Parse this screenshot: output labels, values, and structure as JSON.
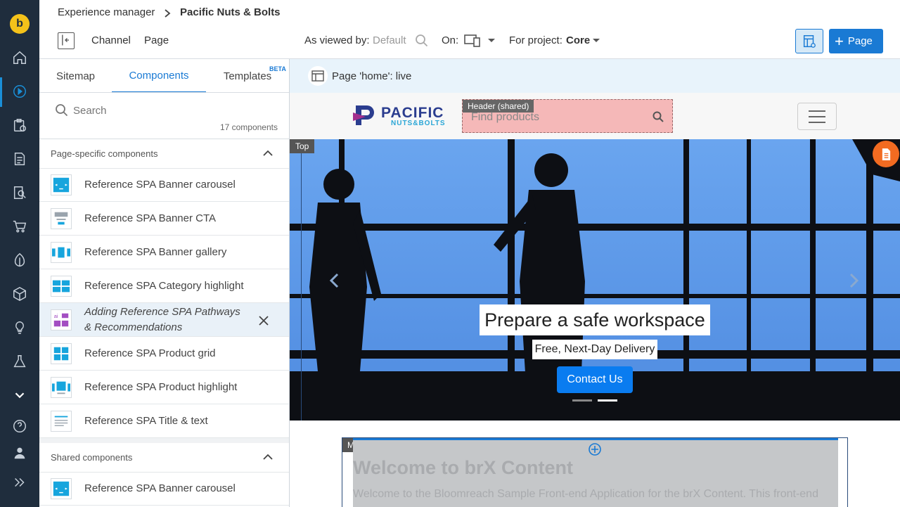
{
  "breadcrumb": {
    "root": "Experience manager",
    "current": "Pacific Nuts & Bolts"
  },
  "toolbar": {
    "channel": "Channel",
    "page": "Page",
    "viewed_by_label": "As viewed by:",
    "viewed_by_value": "Default",
    "on_label": "On:",
    "project_label": "For project:",
    "project_value": "Core",
    "new_page_button": "Page"
  },
  "tabs": {
    "sitemap": "Sitemap",
    "components": "Components",
    "templates": "Templates",
    "beta": "BETA"
  },
  "search": {
    "placeholder": "Search",
    "count": "17 components"
  },
  "sections": {
    "page_specific": "Page-specific components",
    "shared": "Shared components"
  },
  "components": [
    "Reference SPA Banner carousel",
    "Reference SPA Banner CTA",
    "Reference SPA Banner gallery",
    "Reference SPA Category highlight",
    "Adding Reference SPA Pathways & Recommendations",
    "Reference SPA Product grid",
    "Reference SPA Product highlight",
    "Reference SPA Title & text"
  ],
  "shared_components": [
    "Reference SPA Banner carousel"
  ],
  "preview": {
    "page_status": "Page 'home': live",
    "header_tag": "Header (shared)",
    "search_placeholder": "Find products",
    "logo_main": "PACIFIC",
    "logo_sub": "NUTS&BOLTS",
    "top_tag": "Top",
    "banner_title": "Prepare a safe workspace",
    "banner_subtitle": "Free, Next-Day Delivery",
    "banner_cta": "Contact Us",
    "main_tag": "Main",
    "welcome_title": "Welcome to brX Content",
    "welcome_text": "Welcome to the Bloomreach Sample Front-end Application for the brX Content. This front-end"
  },
  "colors": {
    "rail": "#1f2d3d",
    "accent": "#1a8fd8",
    "primary_button": "#1a7ad4",
    "banner_sky": "#5c97e6"
  }
}
